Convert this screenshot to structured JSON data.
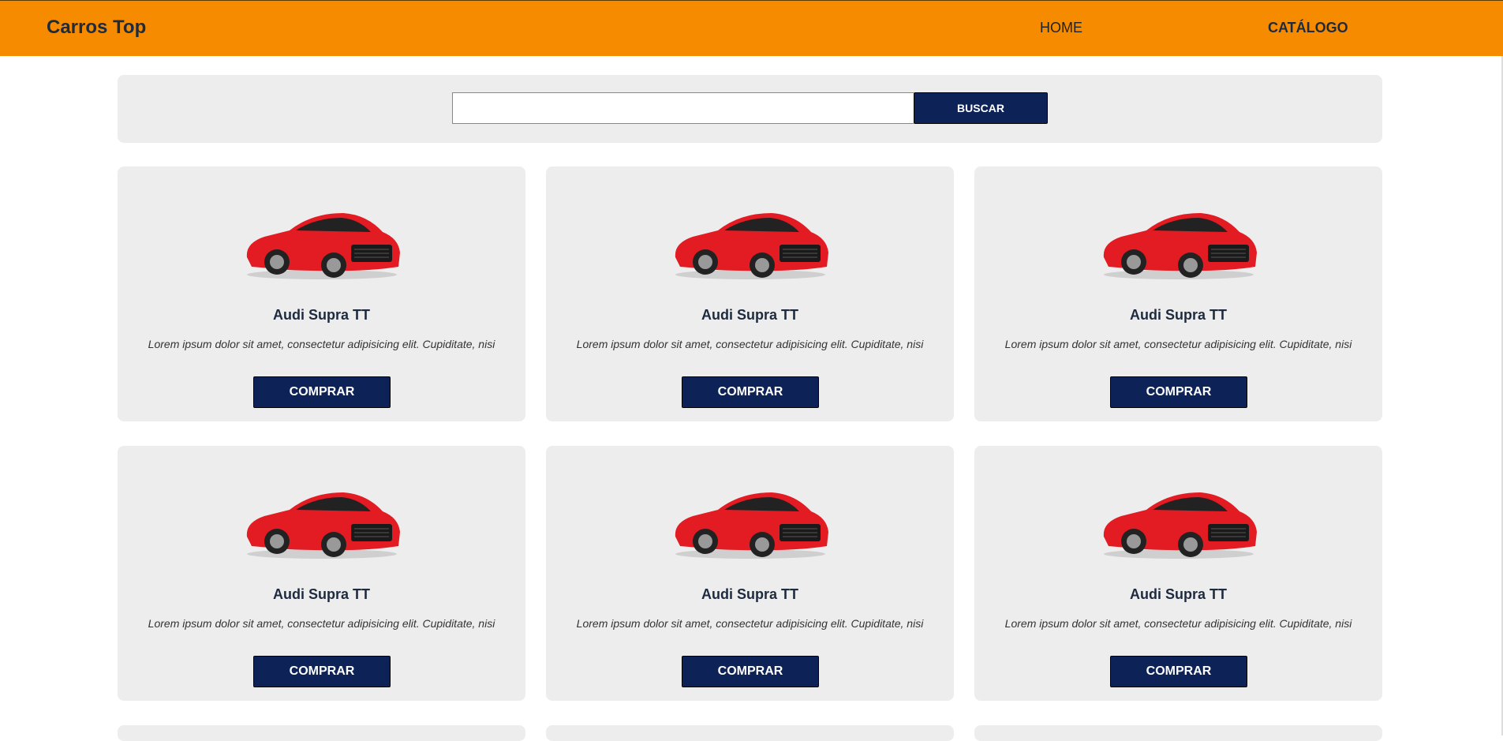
{
  "header": {
    "brand": "Carros Top",
    "nav": [
      {
        "label": "HOME"
      },
      {
        "label": "CATÁLOGO"
      }
    ],
    "bg_color": "#f68b00"
  },
  "search": {
    "value": "",
    "placeholder": "",
    "button_label": "BUSCAR"
  },
  "products": [
    {
      "title": "Audi Supra TT",
      "description": "Lorem ipsum dolor sit amet, consectetur adipisicing elit. Cupiditate, nisi",
      "button_label": "COMPRAR",
      "image": "red-sports-car"
    },
    {
      "title": "Audi Supra TT",
      "description": "Lorem ipsum dolor sit amet, consectetur adipisicing elit. Cupiditate, nisi",
      "button_label": "COMPRAR",
      "image": "red-sports-car"
    },
    {
      "title": "Audi Supra TT",
      "description": "Lorem ipsum dolor sit amet, consectetur adipisicing elit. Cupiditate, nisi",
      "button_label": "COMPRAR",
      "image": "red-sports-car"
    },
    {
      "title": "Audi Supra TT",
      "description": "Lorem ipsum dolor sit amet, consectetur adipisicing elit. Cupiditate, nisi",
      "button_label": "COMPRAR",
      "image": "red-sports-car"
    },
    {
      "title": "Audi Supra TT",
      "description": "Lorem ipsum dolor sit amet, consectetur adipisicing elit. Cupiditate, nisi",
      "button_label": "COMPRAR",
      "image": "red-sports-car"
    },
    {
      "title": "Audi Supra TT",
      "description": "Lorem ipsum dolor sit amet, consectetur adipisicing elit. Cupiditate, nisi",
      "button_label": "COMPRAR",
      "image": "red-sports-car"
    }
  ],
  "colors": {
    "primary_button": "#0d2357",
    "card_bg": "#ededed",
    "car_red": "#e31b23"
  }
}
